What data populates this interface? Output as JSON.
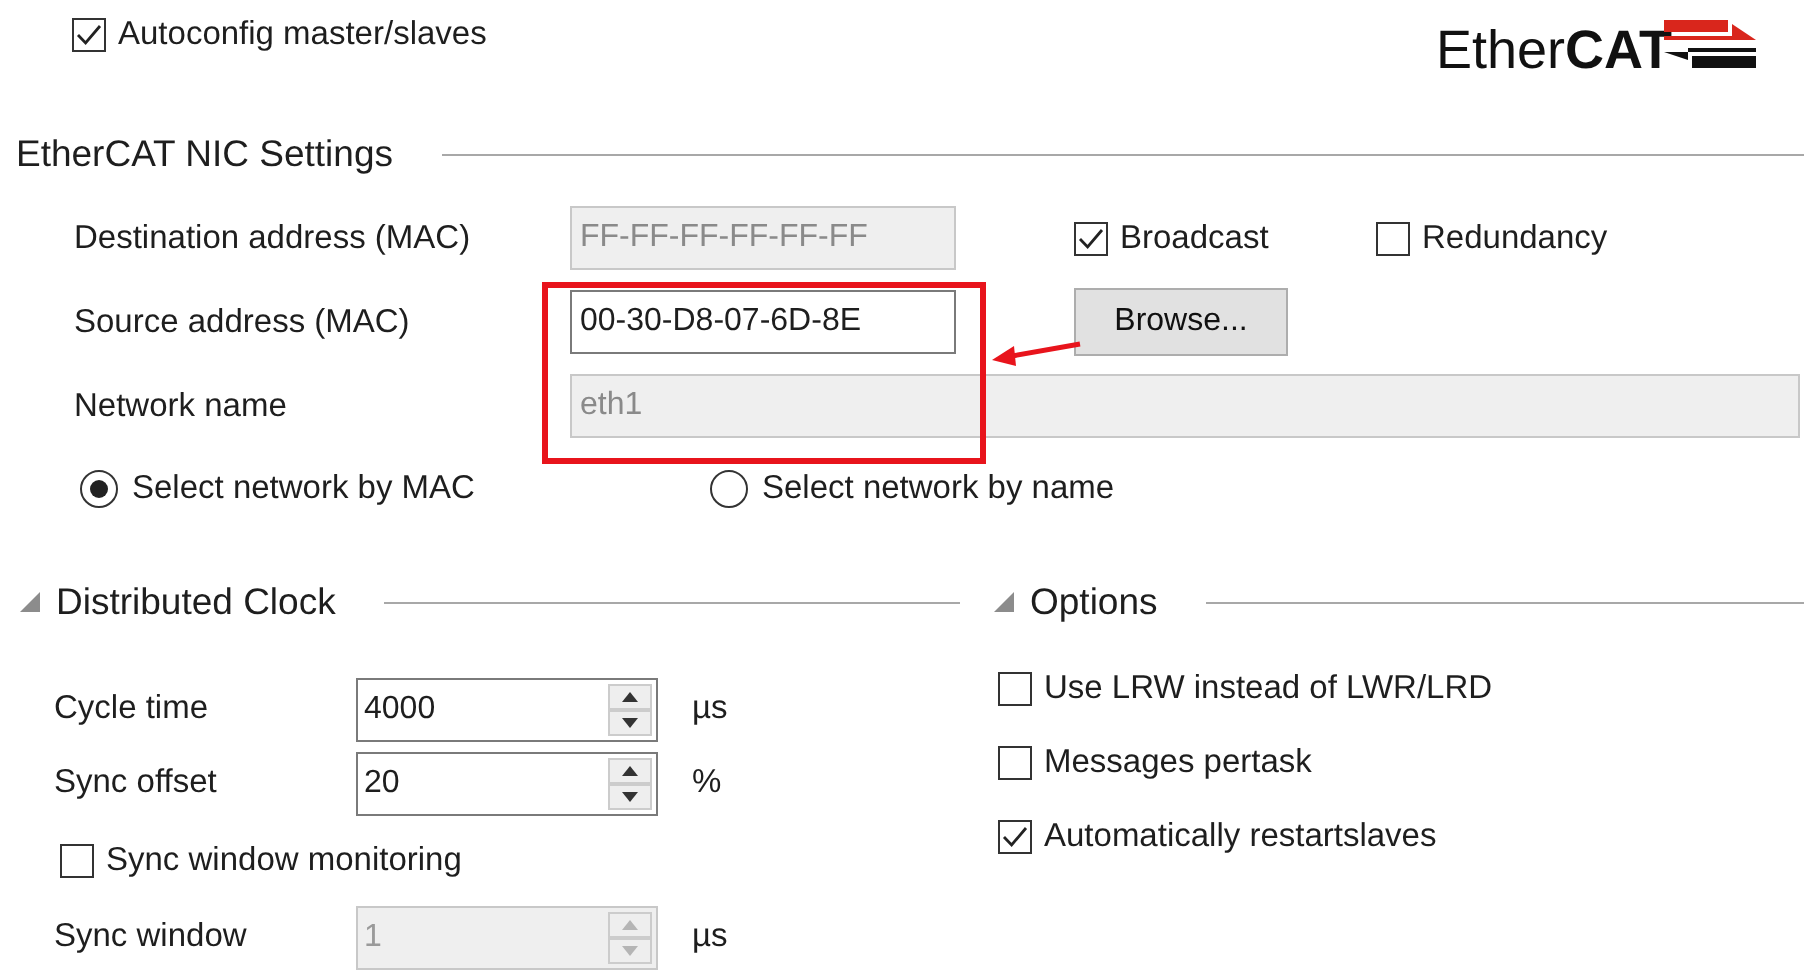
{
  "autoconfig": {
    "label": "Autoconfig master/slaves",
    "checked": true
  },
  "logo": {
    "light": "Ether",
    "bold": "CAT"
  },
  "nic_settings": {
    "title": "EtherCAT NIC Settings",
    "destination": {
      "label": "Destination address (MAC)",
      "value": "FF-FF-FF-FF-FF-FF",
      "disabled": true
    },
    "broadcast": {
      "label": "Broadcast",
      "checked": true
    },
    "redundancy": {
      "label": "Redundancy",
      "checked": false
    },
    "source": {
      "label": "Source address (MAC)",
      "value": "00-30-D8-07-6D-8E",
      "disabled": false
    },
    "browse_button": "Browse...",
    "network_name": {
      "label": "Network name",
      "value": "eth1",
      "disabled": true
    },
    "radios": [
      {
        "label": "Select network by MAC",
        "selected": true
      },
      {
        "label": "Select network by name",
        "selected": false
      }
    ]
  },
  "distributed_clock": {
    "title": "Distributed Clock",
    "expanded": true,
    "rows": [
      {
        "label": "Cycle time",
        "value": "4000",
        "unit": "µs",
        "disabled": false
      },
      {
        "label": "Sync offset",
        "value": "20",
        "unit": "%",
        "disabled": false
      }
    ],
    "sync_window_monitoring": {
      "label": "Sync window monitoring",
      "checked": false
    },
    "sync_window": {
      "label": "Sync window",
      "value": "1",
      "unit": "µs",
      "disabled": true
    }
  },
  "options": {
    "title": "Options",
    "expanded": true,
    "items": [
      {
        "label": "Use LRW instead of LWR/LRD",
        "checked": false
      },
      {
        "label": "Messages pertask",
        "checked": false
      },
      {
        "label": "Automatically restartslaves",
        "checked": true
      }
    ]
  }
}
